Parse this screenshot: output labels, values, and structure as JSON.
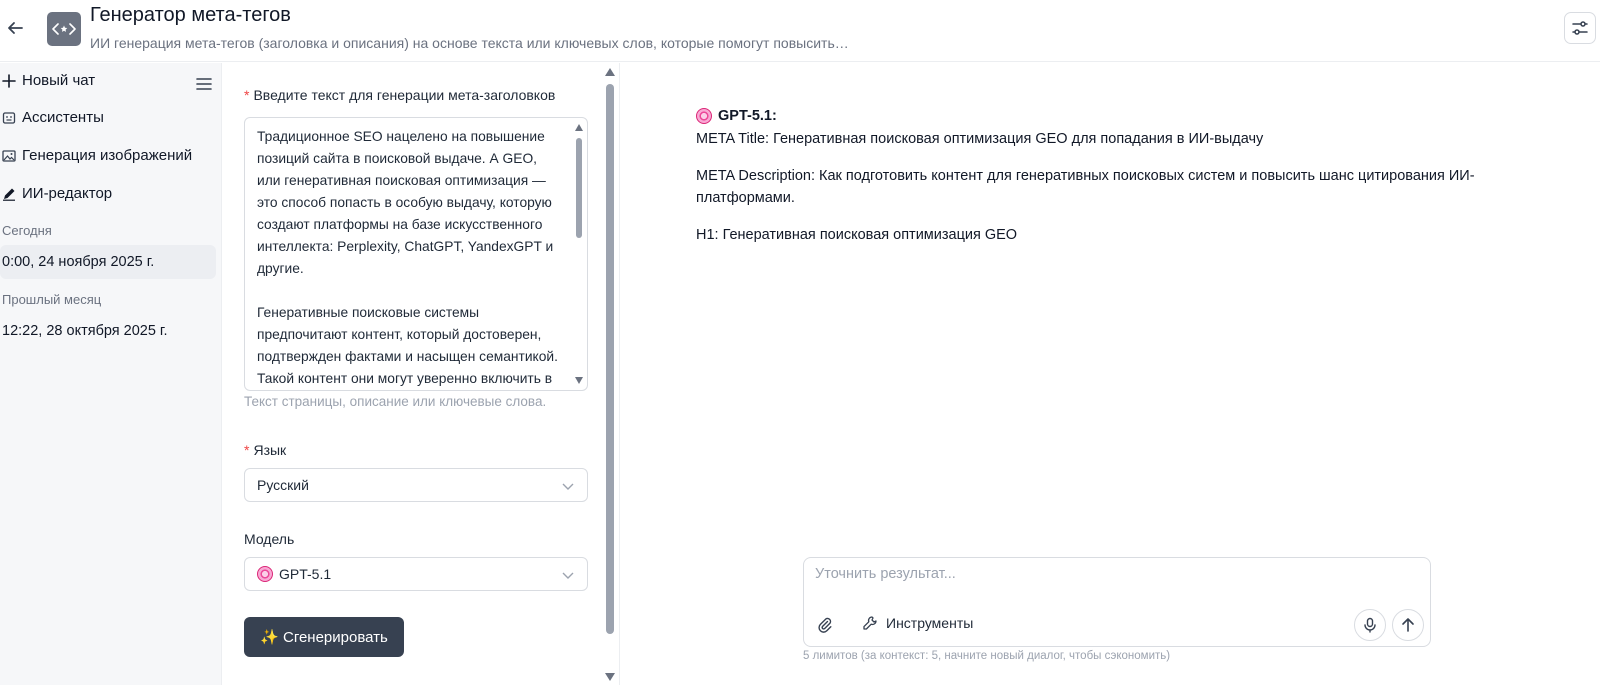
{
  "header": {
    "title": "Генератор мета-тегов",
    "subtitle": "ИИ генерация мета-тегов (заголовка и описания) на основе текста или ключевых слов, которые помогут повысить…",
    "app_icon": "code-sparkle-icon",
    "back_icon": "arrow-left-icon",
    "settings_icon": "sliders-icon"
  },
  "sidebar": {
    "new_chat_label": "Новый чат",
    "items": [
      {
        "label": "Ассистенты",
        "icon": "robot-face-icon"
      },
      {
        "label": "Генерация изображений",
        "icon": "image-icon"
      },
      {
        "label": "ИИ-редактор",
        "icon": "pen-icon"
      }
    ],
    "sections": [
      {
        "title": "Сегодня",
        "chats": [
          "0:00, 24 ноября 2025 г."
        ]
      },
      {
        "title": "Прошлый месяц",
        "chats": [
          "12:22, 28 октября 2025 г."
        ]
      }
    ]
  },
  "form": {
    "text_label": "Введите текст для генерации мета-заголовков",
    "text_value": "Традиционное SEO нацелено на повышение позиций сайта в поисковой выдаче. А GEO, или генеративная поисковая оптимизация — это способ попасть в особую выдачу, которую создают платформы на базе искусственного интеллекта: Perplexity, ChatGPT, YandexGPT и другие.\n\nГенеративные поисковые системы предпочитают контент, который достоверен, подтвержден фактами и насыщен семантикой. Такой контент они могут уверенно включить в",
    "text_hint": "Текст страницы, описание или ключевые слова.",
    "language_label": "Язык",
    "language_value": "Русский",
    "model_label": "Модель",
    "model_value": "GPT-5.1",
    "generate_label": "✨ Сгенерировать"
  },
  "result": {
    "author": "GPT-5.1:",
    "lines": [
      "META Title: Генеративная поисковая оптимизация GEO для попадания в ИИ-выдачу",
      "META Description: Как подготовить контент для генеративных поисковых систем и повысить шанс цитирования ИИ-платформами.",
      "H1: Генеративная поисковая оптимизация GEO"
    ]
  },
  "composer": {
    "placeholder": "Уточнить результат...",
    "tools_label": "Инструменты",
    "limits_text": "5 лимитов (за контекст: 5, начните новый диалог, чтобы сэкономить)"
  },
  "colors": {
    "accent_button": "#374151",
    "required": "#ef4444",
    "model_badge": "#ec4899"
  }
}
